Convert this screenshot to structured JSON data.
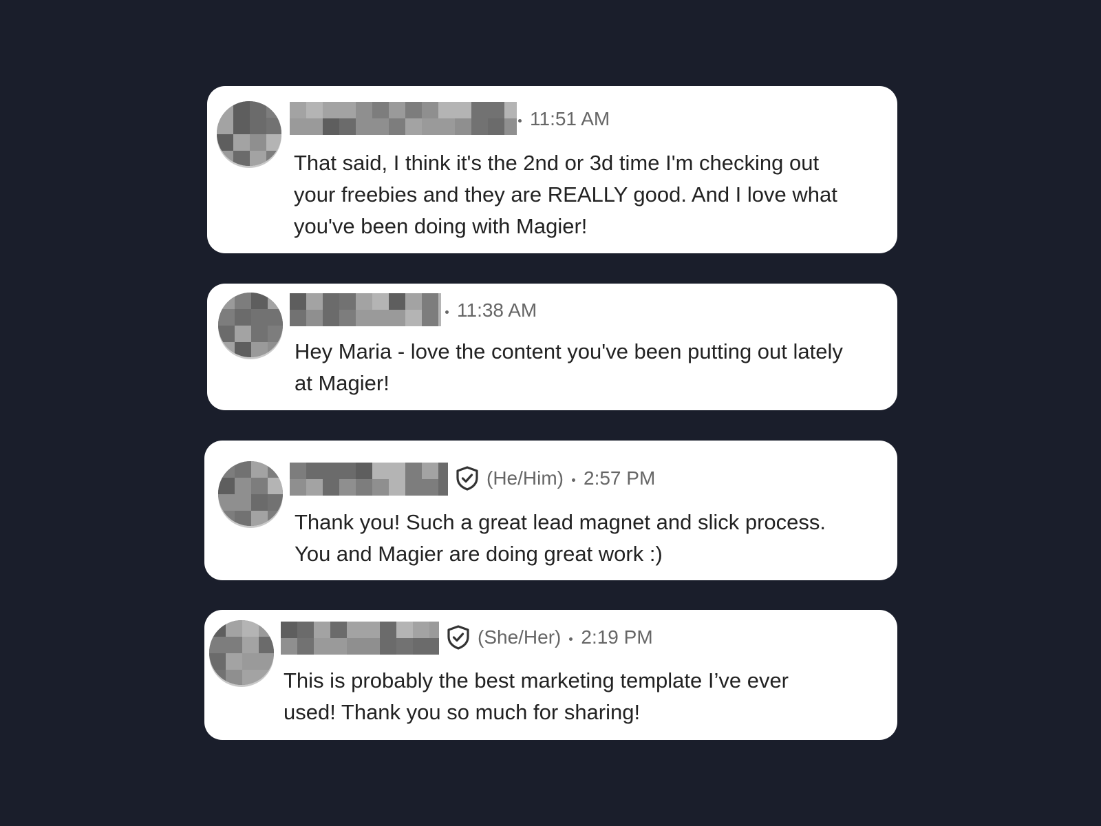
{
  "messages": [
    {
      "time": "11:51 AM",
      "pronouns": "",
      "verified": false,
      "lines": [
        "That said, I think it's the 2nd or 3d time I'm checking out",
        "your freebies and they are REALLY good. And I love what",
        "you've been doing with Magier!"
      ]
    },
    {
      "time": "11:38 AM",
      "pronouns": "",
      "verified": false,
      "lines": [
        "Hey Maria - love the content you've been putting out lately",
        "at Magier!"
      ]
    },
    {
      "time": "2:57 PM",
      "pronouns": "(He/Him)",
      "verified": true,
      "icon": "shield-check-icon",
      "lines": [
        "Thank you! Such a great lead magnet and slick process.",
        "You and Magier are doing great work :)"
      ]
    },
    {
      "time": "2:19 PM",
      "pronouns": "(She/Her)",
      "verified": true,
      "icon": "shield-check-icon",
      "lines": [
        "This is probably the best marketing template I’ve ever",
        "used! Thank you so much for sharing!"
      ]
    }
  ],
  "colors": {
    "background": "#1a1e2b",
    "card": "#ffffff",
    "message_text": "#222222",
    "meta_text": "#666666"
  }
}
